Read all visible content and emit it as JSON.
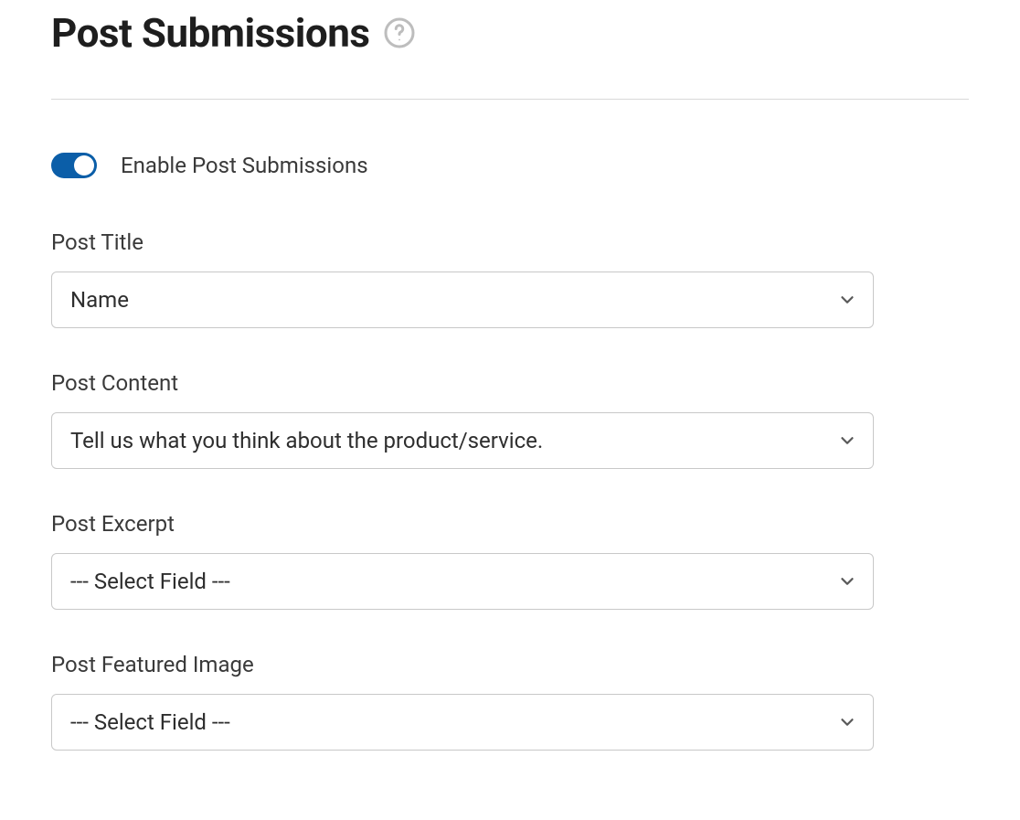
{
  "header": {
    "title": "Post Submissions"
  },
  "toggle": {
    "label": "Enable Post Submissions",
    "enabled": true
  },
  "fields": {
    "postTitle": {
      "label": "Post Title",
      "value": "Name"
    },
    "postContent": {
      "label": "Post Content",
      "value": "Tell us what you think about the product/service."
    },
    "postExcerpt": {
      "label": "Post Excerpt",
      "value": "--- Select Field ---"
    },
    "postFeaturedImage": {
      "label": "Post Featured Image",
      "value": "--- Select Field ---"
    }
  }
}
